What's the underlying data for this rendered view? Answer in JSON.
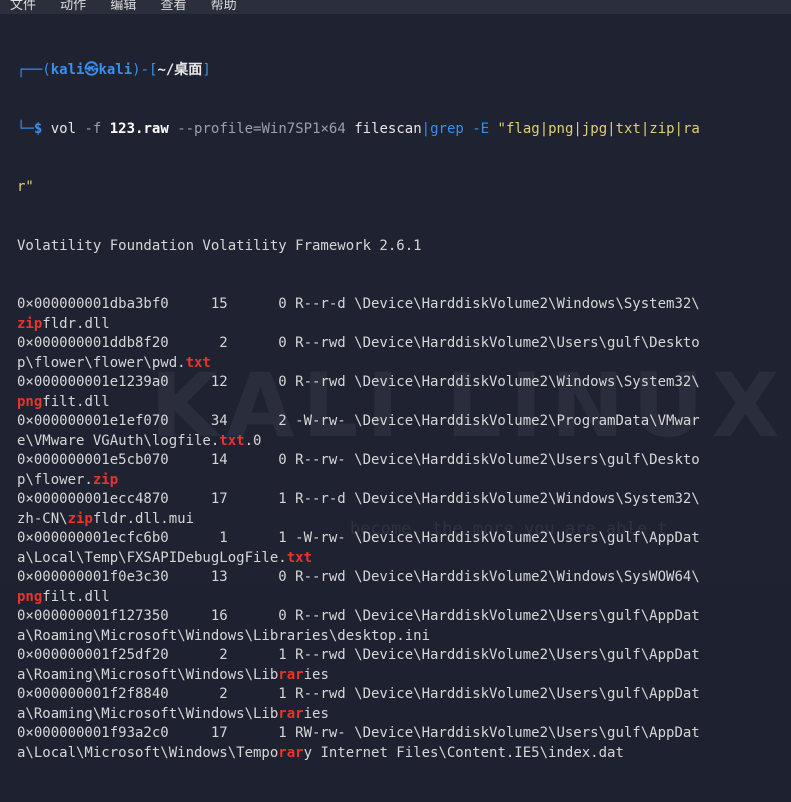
{
  "menu": [
    "文件",
    "动作",
    "编辑",
    "查看",
    "帮助"
  ],
  "prompt": {
    "user": "kali",
    "at": "㉿",
    "host": "kali",
    "path": "~/桌面",
    "command_exe": "vol",
    "command_f": "-f",
    "command_file": "123.raw",
    "command_profile": "--profile=Win7SP1×64",
    "command_plugin": "filescan",
    "command_pipe": "|",
    "command_grep": "grep -E",
    "command_pattern_1": "\"flag|png|jpg|txt|zip|ra",
    "command_pattern_2": "r\""
  },
  "banner": "Volatility Foundation Volatility Framework 2.6.1",
  "watermark": "KALI LINUX",
  "watermark_tagline": "become, the more you are able t",
  "lines": [
    [
      {
        "t": "0×000000001dba3bf0     15      0 R--r-d \\Device\\HarddiskVolume2\\Windows\\System32\\"
      }
    ],
    [
      {
        "t": "zip",
        "h": true
      },
      {
        "t": "fldr.dll"
      }
    ],
    [
      {
        "t": "0×000000001ddb8f20      2      0 R--rwd \\Device\\HarddiskVolume2\\Users\\gulf\\Deskto"
      }
    ],
    [
      {
        "t": "p\\flower\\flower\\pwd."
      },
      {
        "t": "txt",
        "h": true
      }
    ],
    [
      {
        "t": "0×000000001e1239a0     12      0 R--rwd \\Device\\HarddiskVolume2\\Windows\\System32\\"
      }
    ],
    [
      {
        "t": "png",
        "h": true
      },
      {
        "t": "filt.dll"
      }
    ],
    [
      {
        "t": "0×000000001e1ef070     34      2 -W-rw- \\Device\\HarddiskVolume2\\ProgramData\\VMwar"
      }
    ],
    [
      {
        "t": "e\\VMware VGAuth\\logfile."
      },
      {
        "t": "txt",
        "h": true
      },
      {
        "t": ".0"
      }
    ],
    [
      {
        "t": "0×000000001e5cb070     14      0 R--rw- \\Device\\HarddiskVolume2\\Users\\gulf\\Deskto"
      }
    ],
    [
      {
        "t": "p\\flower."
      },
      {
        "t": "zip",
        "h": true
      }
    ],
    [
      {
        "t": "0×000000001ecc4870     17      1 R--r-d \\Device\\HarddiskVolume2\\Windows\\System32\\"
      }
    ],
    [
      {
        "t": "zh-CN\\"
      },
      {
        "t": "zip",
        "h": true
      },
      {
        "t": "fldr.dll.mui"
      }
    ],
    [
      {
        "t": "0×000000001ecfc6b0      1      1 -W-rw- \\Device\\HarddiskVolume2\\Users\\gulf\\AppDat"
      }
    ],
    [
      {
        "t": "a\\Local\\Temp\\FXSAPIDebugLogFile."
      },
      {
        "t": "txt",
        "h": true
      }
    ],
    [
      {
        "t": "0×000000001f0e3c30     13      0 R--rwd \\Device\\HarddiskVolume2\\Windows\\SysWOW64\\"
      }
    ],
    [
      {
        "t": "png",
        "h": true
      },
      {
        "t": "filt.dll"
      }
    ],
    [
      {
        "t": "0×000000001f127350     16      0 R--rwd \\Device\\HarddiskVolume2\\Users\\gulf\\AppDat"
      }
    ],
    [
      {
        "t": "a\\Roaming\\Microsoft\\Windows\\Libraries\\desktop.ini"
      }
    ],
    [
      {
        "t": "0×000000001f25df20      2      1 R--rwd \\Device\\HarddiskVolume2\\Users\\gulf\\AppDat"
      }
    ],
    [
      {
        "t": "a\\Roaming\\Microsoft\\Windows\\Lib"
      },
      {
        "t": "rar",
        "h": true
      },
      {
        "t": "ies"
      }
    ],
    [
      {
        "t": "0×000000001f2f8840      2      1 R--rwd \\Device\\HarddiskVolume2\\Users\\gulf\\AppDat"
      }
    ],
    [
      {
        "t": "a\\Roaming\\Microsoft\\Windows\\Lib"
      },
      {
        "t": "rar",
        "h": true
      },
      {
        "t": "ies"
      }
    ],
    [
      {
        "t": "0×000000001f93a2c0     17      1 RW-rw- \\Device\\HarddiskVolume2\\Users\\gulf\\AppDat"
      }
    ],
    [
      {
        "t": "a\\Local\\Microsoft\\Windows\\Tempo"
      },
      {
        "t": "rar",
        "h": true
      },
      {
        "t": "y Internet Files\\Content.IE5\\index.dat"
      }
    ]
  ],
  "colors": {
    "background": "#1f2331",
    "highlight": "#e8342c",
    "prompt": "#3b8eea",
    "string": "#e0d070"
  }
}
